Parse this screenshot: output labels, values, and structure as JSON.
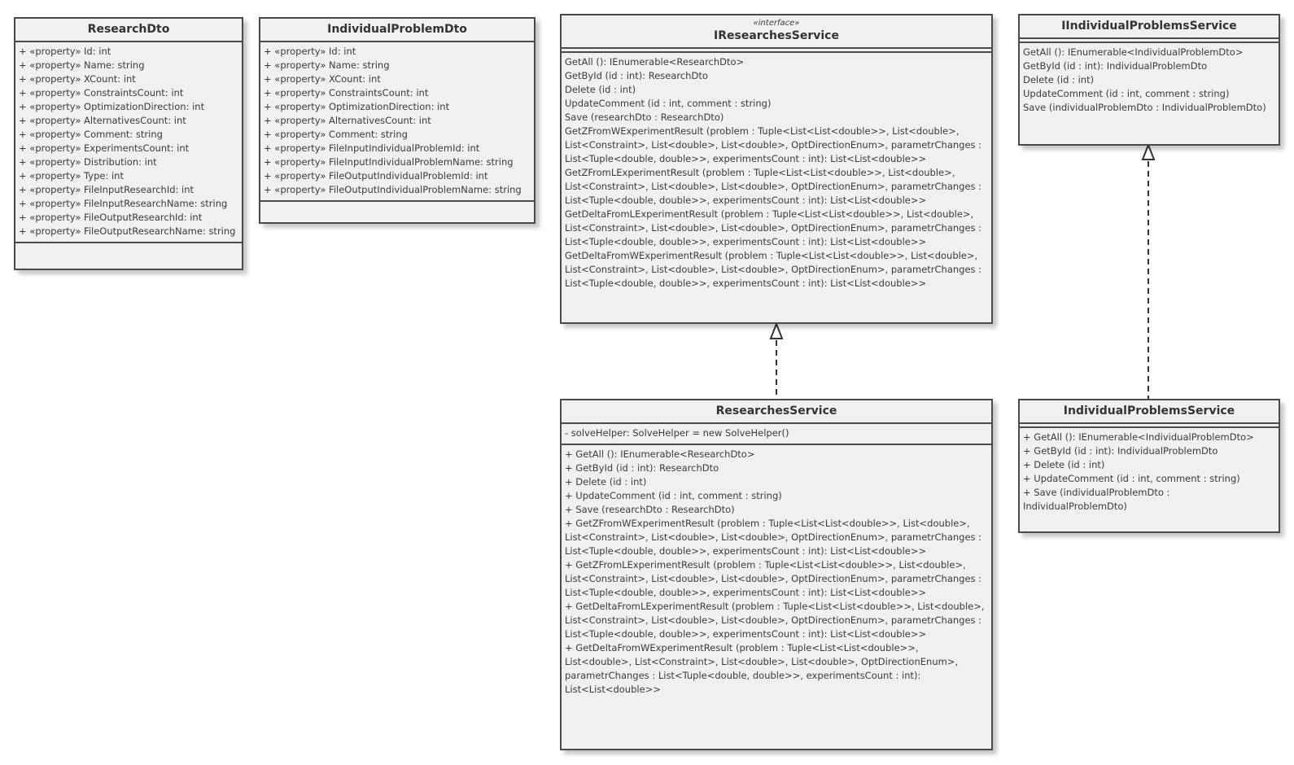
{
  "classes": {
    "research_dto": {
      "name": "ResearchDto",
      "attributes": [
        "+ «property» Id: int",
        "+ «property» Name: string",
        "+ «property» XCount: int",
        "+ «property» ConstraintsCount: int",
        "+ «property» OptimizationDirection: int",
        "+ «property» AlternativesCount: int",
        "+ «property» Comment: string",
        "+ «property» ExperimentsCount: int",
        "+ «property» Distribution: int",
        "+ «property» Type: int",
        "+ «property» FileInputResearchId: int",
        "+ «property» FileInputResearchName: string",
        "+ «property» FileOutputResearchId: int",
        "+ «property» FileOutputResearchName: string"
      ]
    },
    "individual_problem_dto": {
      "name": "IndividualProblemDto",
      "attributes": [
        "+ «property» Id: int",
        "+ «property» Name: string",
        "+ «property» XCount: int",
        "+ «property» ConstraintsCount: int",
        "+ «property» OptimizationDirection: int",
        "+ «property» AlternativesCount: int",
        "+ «property» Comment: string",
        "+ «property» FileInputIndividualProblemId: int",
        "+ «property» FileInputIndividualProblemName: string",
        "+ «property» FileOutputIndividualProblemId: int",
        "+ «property» FileOutputIndividualProblemName: string"
      ]
    },
    "i_researches_service": {
      "stereotype": "«interface»",
      "name": "IResearchesService",
      "operations": [
        "GetAll (): IEnumerable<ResearchDto>",
        "GetById (id : int): ResearchDto",
        "Delete (id : int)",
        "UpdateComment (id : int, comment : string)",
        "Save (researchDto : ResearchDto)",
        "GetZFromWExperimentResult (problem : Tuple<List<List<double>>, List<double>, List<Constraint>, List<double>, List<double>, OptDirectionEnum>, parametrChanges : List<Tuple<double, double>>, experimentsCount : int): List<List<double>>",
        "GetZFromLExperimentResult (problem : Tuple<List<List<double>>, List<double>, List<Constraint>, List<double>, List<double>, OptDirectionEnum>, parametrChanges : List<Tuple<double, double>>, experimentsCount : int): List<List<double>>",
        "GetDeltaFromLExperimentResult (problem : Tuple<List<List<double>>, List<double>, List<Constraint>, List<double>, List<double>, OptDirectionEnum>, parametrChanges : List<Tuple<double, double>>, experimentsCount : int): List<List<double>>",
        "GetDeltaFromWExperimentResult (problem : Tuple<List<List<double>>, List<double>, List<Constraint>, List<double>, List<double>, OptDirectionEnum>, parametrChanges : List<Tuple<double, double>>, experimentsCount : int): List<List<double>>"
      ]
    },
    "i_individual_problems_service": {
      "name": "IIndividualProblemsService",
      "operations": [
        "GetAll (): IEnumerable<IndividualProblemDto>",
        "GetById (id : int): IndividualProblemDto",
        "Delete (id : int)",
        "UpdateComment (id : int, comment : string)",
        "Save (individualProblemDto : IndividualProblemDto)"
      ]
    },
    "researches_service": {
      "name": "ResearchesService",
      "attributes": [
        "- solveHelper: SolveHelper = new SolveHelper()"
      ],
      "operations": [
        "+ GetAll (): IEnumerable<ResearchDto>",
        "+ GetById (id : int): ResearchDto",
        "+ Delete (id : int)",
        "+ UpdateComment (id : int, comment : string)",
        "+ Save (researchDto : ResearchDto)",
        "+ GetZFromWExperimentResult (problem : Tuple<List<List<double>>, List<double>, List<Constraint>, List<double>, List<double>, OptDirectionEnum>, parametrChanges : List<Tuple<double, double>>, experimentsCount : int): List<List<double>>",
        "+ GetZFromLExperimentResult (problem : Tuple<List<List<double>>, List<double>, List<Constraint>, List<double>, List<double>, OptDirectionEnum>, parametrChanges : List<Tuple<double, double>>, experimentsCount : int): List<List<double>>",
        "+ GetDeltaFromLExperimentResult (problem : Tuple<List<List<double>>, List<double>, List<Constraint>, List<double>, List<double>, OptDirectionEnum>, parametrChanges : List<Tuple<double, double>>, experimentsCount : int): List<List<double>>",
        "+ GetDeltaFromWExperimentResult (problem : Tuple<List<List<double>>, List<double>, List<Constraint>, List<double>, List<double>, OptDirectionEnum>, parametrChanges : List<Tuple<double, double>>, experimentsCount : int): List<List<double>>"
      ]
    },
    "individual_problems_service": {
      "name": "IndividualProblemsService",
      "operations": [
        "+ GetAll (): IEnumerable<IndividualProblemDto>",
        "+ GetById (id : int): IndividualProblemDto",
        "+ Delete (id : int)",
        "+ UpdateComment (id : int, comment : string)",
        "+ Save (individualProblemDto : IndividualProblemDto)"
      ]
    }
  },
  "relations": [
    {
      "type": "realization",
      "from": "ResearchesService",
      "to": "IResearchesService"
    },
    {
      "type": "realization",
      "from": "IndividualProblemsService",
      "to": "IIndividualProblemsService"
    }
  ]
}
